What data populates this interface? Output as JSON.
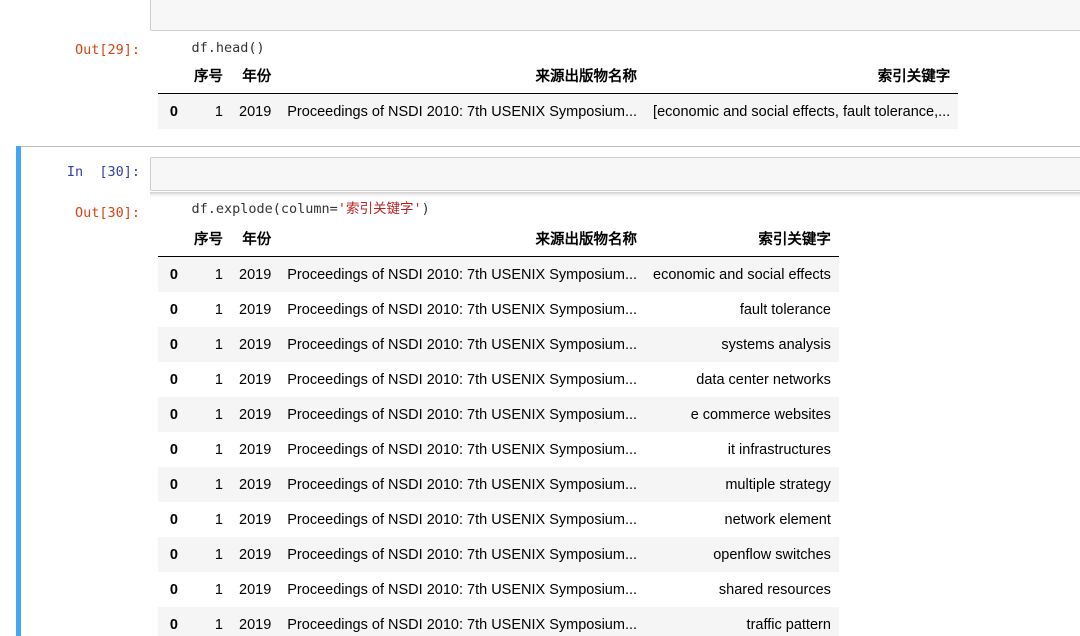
{
  "cell29": {
    "code": "df.head()",
    "out_prompt": "Out[29]:",
    "table": {
      "columns": [
        "",
        "序号",
        "年份",
        "来源出版物名称",
        "索引关键字"
      ],
      "rows": [
        [
          "0",
          "1",
          "2019",
          "Proceedings of NSDI 2010: 7th USENIX Symposium...",
          "[economic and social effects, fault tolerance,..."
        ]
      ]
    }
  },
  "cell30": {
    "in_prompt": "In  [30]:",
    "code_prefix": "df.explode(column=",
    "code_string": "'索引关键字'",
    "code_suffix": ")",
    "out_prompt": "Out[30]:",
    "table": {
      "columns": [
        "",
        "序号",
        "年份",
        "来源出版物名称",
        "索引关键字"
      ],
      "rows": [
        [
          "0",
          "1",
          "2019",
          "Proceedings of NSDI 2010: 7th USENIX Symposium...",
          "economic and social effects"
        ],
        [
          "0",
          "1",
          "2019",
          "Proceedings of NSDI 2010: 7th USENIX Symposium...",
          "fault tolerance"
        ],
        [
          "0",
          "1",
          "2019",
          "Proceedings of NSDI 2010: 7th USENIX Symposium...",
          "systems analysis"
        ],
        [
          "0",
          "1",
          "2019",
          "Proceedings of NSDI 2010: 7th USENIX Symposium...",
          "data center networks"
        ],
        [
          "0",
          "1",
          "2019",
          "Proceedings of NSDI 2010: 7th USENIX Symposium...",
          "e commerce websites"
        ],
        [
          "0",
          "1",
          "2019",
          "Proceedings of NSDI 2010: 7th USENIX Symposium...",
          "it infrastructures"
        ],
        [
          "0",
          "1",
          "2019",
          "Proceedings of NSDI 2010: 7th USENIX Symposium...",
          "multiple strategy"
        ],
        [
          "0",
          "1",
          "2019",
          "Proceedings of NSDI 2010: 7th USENIX Symposium...",
          "network element"
        ],
        [
          "0",
          "1",
          "2019",
          "Proceedings of NSDI 2010: 7th USENIX Symposium...",
          "openflow switches"
        ],
        [
          "0",
          "1",
          "2019",
          "Proceedings of NSDI 2010: 7th USENIX Symposium...",
          "shared resources"
        ],
        [
          "0",
          "1",
          "2019",
          "Proceedings of NSDI 2010: 7th USENIX Symposium...",
          "traffic pattern"
        ]
      ]
    }
  },
  "colors": {
    "selection_bar": "#42a5f5",
    "prompt_in": "#303f9f",
    "prompt_out": "#d84315",
    "code_string": "#ba2121"
  }
}
